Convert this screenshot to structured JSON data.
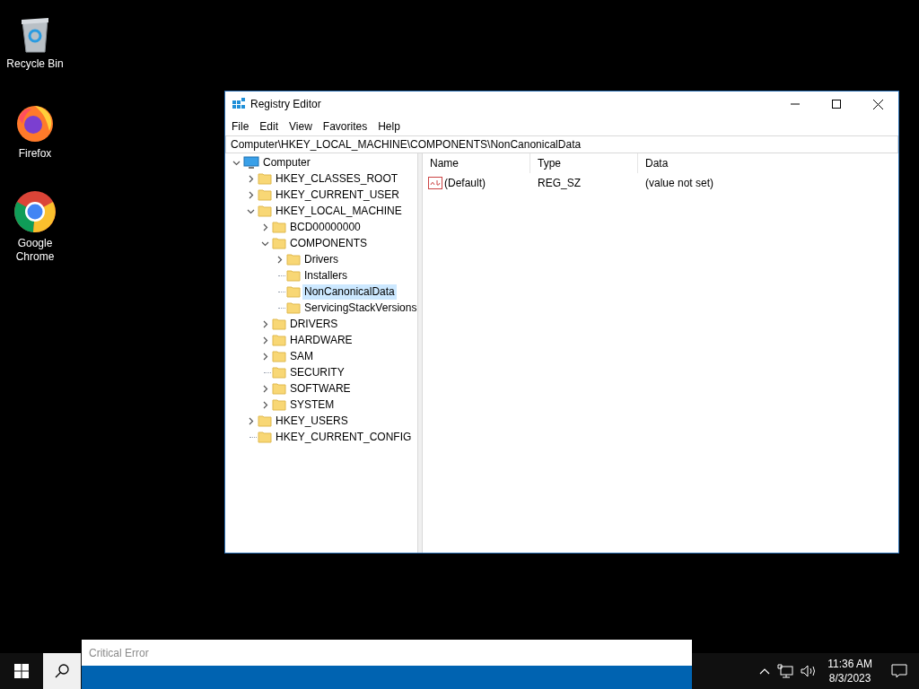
{
  "desktop_icons": [
    {
      "kind": "recycle",
      "label": "Recycle Bin"
    },
    {
      "kind": "firefox",
      "label": "Firefox"
    },
    {
      "kind": "chrome",
      "label": "Google Chrome"
    }
  ],
  "window": {
    "title": "Registry Editor",
    "menu": [
      "File",
      "Edit",
      "View",
      "Favorites",
      "Help"
    ],
    "address": "Computer\\HKEY_LOCAL_MACHINE\\COMPONENTS\\NonCanonicalData",
    "tree": [
      {
        "label": "Computer",
        "kind": "root",
        "selected": false,
        "children": [
          {
            "label": "HKEY_CLASSES_ROOT",
            "kind": "collapsed",
            "selected": false
          },
          {
            "label": "HKEY_CURRENT_USER",
            "kind": "collapsed",
            "selected": false
          },
          {
            "label": "HKEY_LOCAL_MACHINE",
            "kind": "expanded",
            "selected": false,
            "children": [
              {
                "label": "BCD00000000",
                "kind": "collapsed",
                "selected": false
              },
              {
                "label": "COMPONENTS",
                "kind": "expanded",
                "selected": false,
                "children": [
                  {
                    "label": "Drivers",
                    "kind": "collapsed",
                    "selected": false
                  },
                  {
                    "label": "Installers",
                    "kind": "leaf",
                    "selected": false
                  },
                  {
                    "label": "NonCanonicalData",
                    "kind": "leaf",
                    "selected": true
                  },
                  {
                    "label": "ServicingStackVersions",
                    "kind": "leaf",
                    "selected": false
                  }
                ]
              },
              {
                "label": "DRIVERS",
                "kind": "collapsed",
                "selected": false
              },
              {
                "label": "HARDWARE",
                "kind": "collapsed",
                "selected": false
              },
              {
                "label": "SAM",
                "kind": "collapsed",
                "selected": false
              },
              {
                "label": "SECURITY",
                "kind": "leaf",
                "selected": false
              },
              {
                "label": "SOFTWARE",
                "kind": "collapsed",
                "selected": false
              },
              {
                "label": "SYSTEM",
                "kind": "collapsed",
                "selected": false
              }
            ]
          },
          {
            "label": "HKEY_USERS",
            "kind": "collapsed",
            "selected": false
          },
          {
            "label": "HKEY_CURRENT_CONFIG",
            "kind": "leaf",
            "selected": false
          }
        ]
      }
    ],
    "columns": [
      "Name",
      "Type",
      "Data"
    ],
    "values": [
      {
        "name": "(Default)",
        "type": "REG_SZ",
        "data": "(value not set)"
      }
    ]
  },
  "search": {
    "placeholder": "Critical Error"
  },
  "taskbar": {
    "time": "11:36 AM",
    "date": "8/3/2023"
  }
}
